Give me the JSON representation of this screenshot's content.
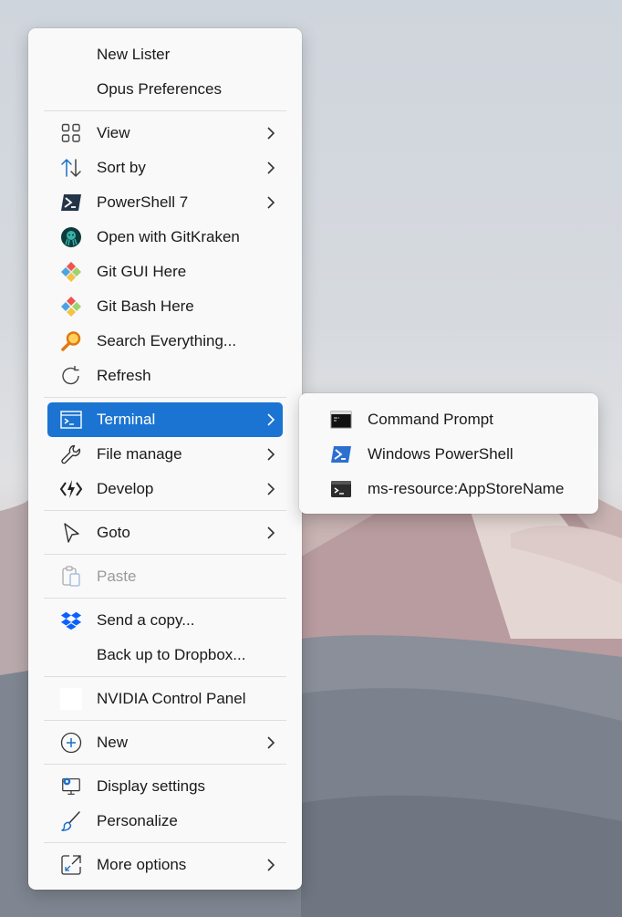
{
  "main_menu": {
    "top_items": [
      {
        "label": "New Lister"
      },
      {
        "label": "Opus Preferences"
      }
    ],
    "group1": [
      {
        "label": "View",
        "icon": "grid-icon",
        "submenu": true
      },
      {
        "label": "Sort by",
        "icon": "sort-icon",
        "submenu": true
      },
      {
        "label": "PowerShell 7",
        "icon": "powershell-icon",
        "submenu": true
      },
      {
        "label": "Open with GitKraken",
        "icon": "gitkraken-icon",
        "submenu": false
      },
      {
        "label": "Git GUI Here",
        "icon": "git-gui-icon",
        "submenu": false
      },
      {
        "label": "Git Bash Here",
        "icon": "git-bash-icon",
        "submenu": false
      },
      {
        "label": "Search Everything...",
        "icon": "magnifier-icon",
        "submenu": false
      },
      {
        "label": "Refresh",
        "icon": "refresh-icon",
        "submenu": false
      }
    ],
    "group2": [
      {
        "label": "Terminal",
        "icon": "terminal-icon",
        "submenu": true,
        "active": true
      },
      {
        "label": "File manage",
        "icon": "wrench-icon",
        "submenu": true
      },
      {
        "label": "Develop",
        "icon": "develop-icon",
        "submenu": true
      }
    ],
    "goto": {
      "label": "Goto",
      "icon": "cursor-icon",
      "submenu": true
    },
    "paste": {
      "label": "Paste",
      "icon": "clipboard-icon",
      "disabled": true
    },
    "dropbox": [
      {
        "label": "Send a copy...",
        "icon": "dropbox-icon"
      },
      {
        "label": "Back up to Dropbox..."
      }
    ],
    "nvidia": {
      "label": "NVIDIA Control Panel",
      "icon": "nvidia-icon"
    },
    "new": {
      "label": "New",
      "icon": "plus-circle-icon",
      "submenu": true
    },
    "display": [
      {
        "label": "Display settings",
        "icon": "display-settings-icon"
      },
      {
        "label": "Personalize",
        "icon": "brush-icon"
      }
    ],
    "more": {
      "label": "More options",
      "icon": "expand-icon",
      "submenu": true
    }
  },
  "sub_menu": {
    "items": [
      {
        "label": "Command Prompt",
        "icon": "cmd-icon"
      },
      {
        "label": "Windows PowerShell",
        "icon": "windows-powershell-icon"
      },
      {
        "label": "ms-resource:AppStoreName",
        "icon": "terminal-app-icon"
      }
    ]
  },
  "colors": {
    "accent": "#1b74d2",
    "menu_bg": "#f9f9f9",
    "separator": "#dedede",
    "disabled_text": "#9a9a9a"
  }
}
